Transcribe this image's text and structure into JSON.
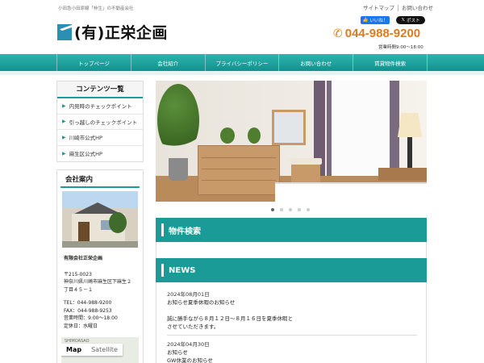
{
  "header": {
    "tagline": "小田急小田原線「柿生」の不動産会社",
    "top_links": [
      "サイトマップ",
      "お問い合わせ"
    ],
    "fb_like": "いいね！",
    "x_post": "ポスト",
    "logo_text": "(有)正栄企画",
    "phone": "044-988-9200",
    "hours": "営業時間9:00～18:00"
  },
  "nav": {
    "items": [
      "トップページ",
      "会社紹介",
      "プライバシーポリシー",
      "お問い合わせ",
      "賃貸物件検索"
    ]
  },
  "sidebar": {
    "contents_title": "コンテンツ一覧",
    "contents_items": [
      "内見時のチェックポイント",
      "引っ越しのチェックポイント",
      "川崎市公式HP",
      "麻生区公式HP"
    ],
    "company_title": "会社案内",
    "company_name": "有限会社正栄企画",
    "postal": "〒215-0023",
    "address1": "神奈川県川崎市麻生区下麻生２",
    "address2": "丁目４５－１",
    "tel": "TEL：044-988-9200",
    "fax": "FAX：044-988-9253",
    "business_hours": "営業時間：9:00～18:00",
    "closed": "定休日：水曜日",
    "map_label": "SHIMOASAO",
    "map_tab_map": "Map",
    "map_tab_satellite": "Satellite"
  },
  "main": {
    "slider_dots": 5,
    "slider_active": 0,
    "property_search_title": "物件検索",
    "news_title": "NEWS",
    "news": [
      {
        "date": "2024年08月01日",
        "title": "お知らせ夏季休暇のお知らせ",
        "body1": "誠に勝手ながら８月１２日～８月１６日を夏季休暇と",
        "body2": "させていただきます。"
      },
      {
        "date": "2024年04月30日",
        "title": "お知らせ",
        "body1": "GW休業のお知らせ"
      }
    ]
  },
  "colors": {
    "accent": "#1a9b97",
    "phone": "#e07a1e",
    "logo": "#2a8fb0"
  }
}
